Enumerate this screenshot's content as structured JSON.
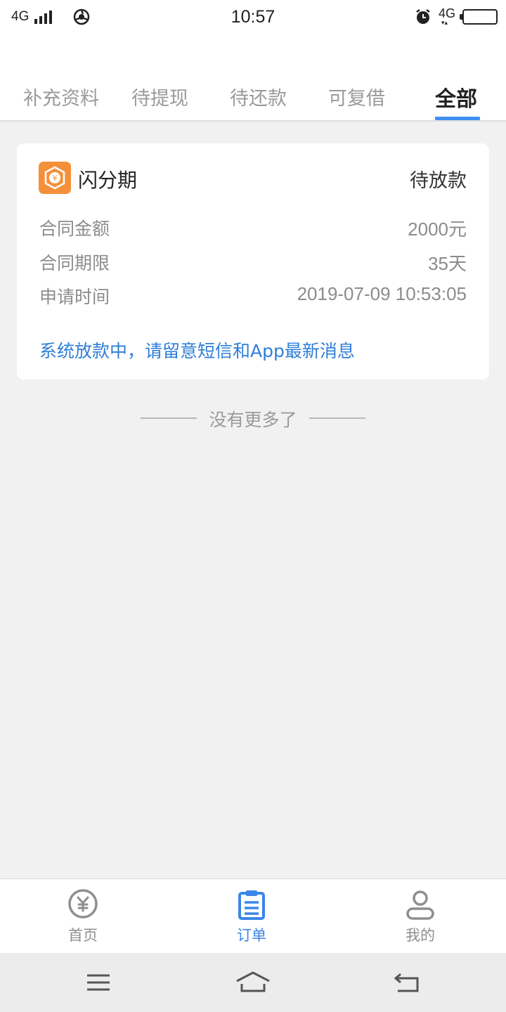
{
  "status_bar": {
    "network_left": "4G",
    "time": "10:57",
    "network_right": "4G"
  },
  "tabs": [
    {
      "label": "补充资料",
      "active": false
    },
    {
      "label": "待提现",
      "active": false
    },
    {
      "label": "待还款",
      "active": false
    },
    {
      "label": "可复借",
      "active": false
    },
    {
      "label": "全部",
      "active": true
    }
  ],
  "order": {
    "brand_icon": "yen-shield-icon",
    "brand_name": "闪分期",
    "status": "待放款",
    "rows": [
      {
        "label": "合同金额",
        "value": "2000元"
      },
      {
        "label": "合同期限",
        "value": "35天"
      },
      {
        "label": "申请时间",
        "value": "2019-07-09 10:53:05"
      }
    ],
    "notice": "系统放款中，请留意短信和App最新消息"
  },
  "list_end_text": "没有更多了",
  "bottom_tabs": [
    {
      "label": "首页",
      "icon": "yen-circle-icon",
      "active": false
    },
    {
      "label": "订单",
      "icon": "clipboard-icon",
      "active": true
    },
    {
      "label": "我的",
      "icon": "person-icon",
      "active": false
    }
  ],
  "colors": {
    "accent": "#3f8ff3",
    "notice_blue": "#2f7ed8",
    "brand_orange": "#f5903a",
    "background": "#f1f1f1"
  }
}
